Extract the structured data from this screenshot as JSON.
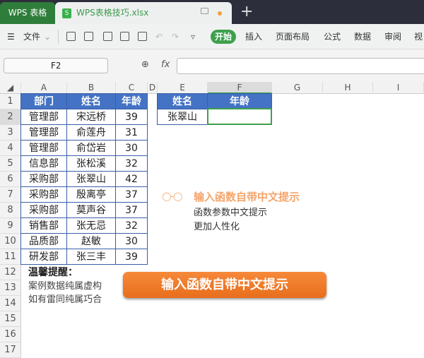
{
  "tabs": {
    "app": "WPS 表格",
    "file": "WPS表格技巧.xlsx",
    "file_icon": "S",
    "new_tab": "+"
  },
  "toolbar": {
    "menu": "文件",
    "start": "开始",
    "items": [
      "插入",
      "页面布局",
      "公式",
      "数据",
      "审阅",
      "视"
    ]
  },
  "formula_bar": {
    "name_box": "F2",
    "fx": "fx",
    "value": ""
  },
  "columns": [
    "A",
    "B",
    "C",
    "D",
    "E",
    "F",
    "G",
    "H",
    "I"
  ],
  "rows": [
    "1",
    "2",
    "3",
    "4",
    "5",
    "6",
    "7",
    "8",
    "9",
    "10",
    "11",
    "12",
    "13",
    "14",
    "15",
    "16",
    "17"
  ],
  "table": {
    "headers": [
      "部门",
      "姓名",
      "年龄"
    ],
    "rows": [
      [
        "管理部",
        "宋远桥",
        "39"
      ],
      [
        "管理部",
        "俞莲舟",
        "31"
      ],
      [
        "管理部",
        "俞岱岩",
        "30"
      ],
      [
        "信息部",
        "张松溪",
        "32"
      ],
      [
        "采购部",
        "张翠山",
        "42"
      ],
      [
        "采购部",
        "殷离亭",
        "37"
      ],
      [
        "采购部",
        "莫声谷",
        "37"
      ],
      [
        "销售部",
        "张无忌",
        "32"
      ],
      [
        "品质部",
        "赵敏",
        "30"
      ],
      [
        "研发部",
        "张三丰",
        "39"
      ]
    ]
  },
  "lookup": {
    "headers": [
      "姓名",
      "年龄"
    ],
    "name": "张翠山",
    "age": ""
  },
  "note": {
    "title": "温馨提醒：",
    "line1": "案例数据纯属虚构",
    "line2": "如有雷同纯属巧合"
  },
  "tip": {
    "title": "输入函数自带中文提示",
    "line1": "函数参数中文提示",
    "line2": "更加人性化"
  },
  "banner": "输入函数自带中文提示",
  "colors": {
    "header_blue": "#4472c4",
    "accent_green": "#3ea04d",
    "orange": "#f07a28"
  }
}
